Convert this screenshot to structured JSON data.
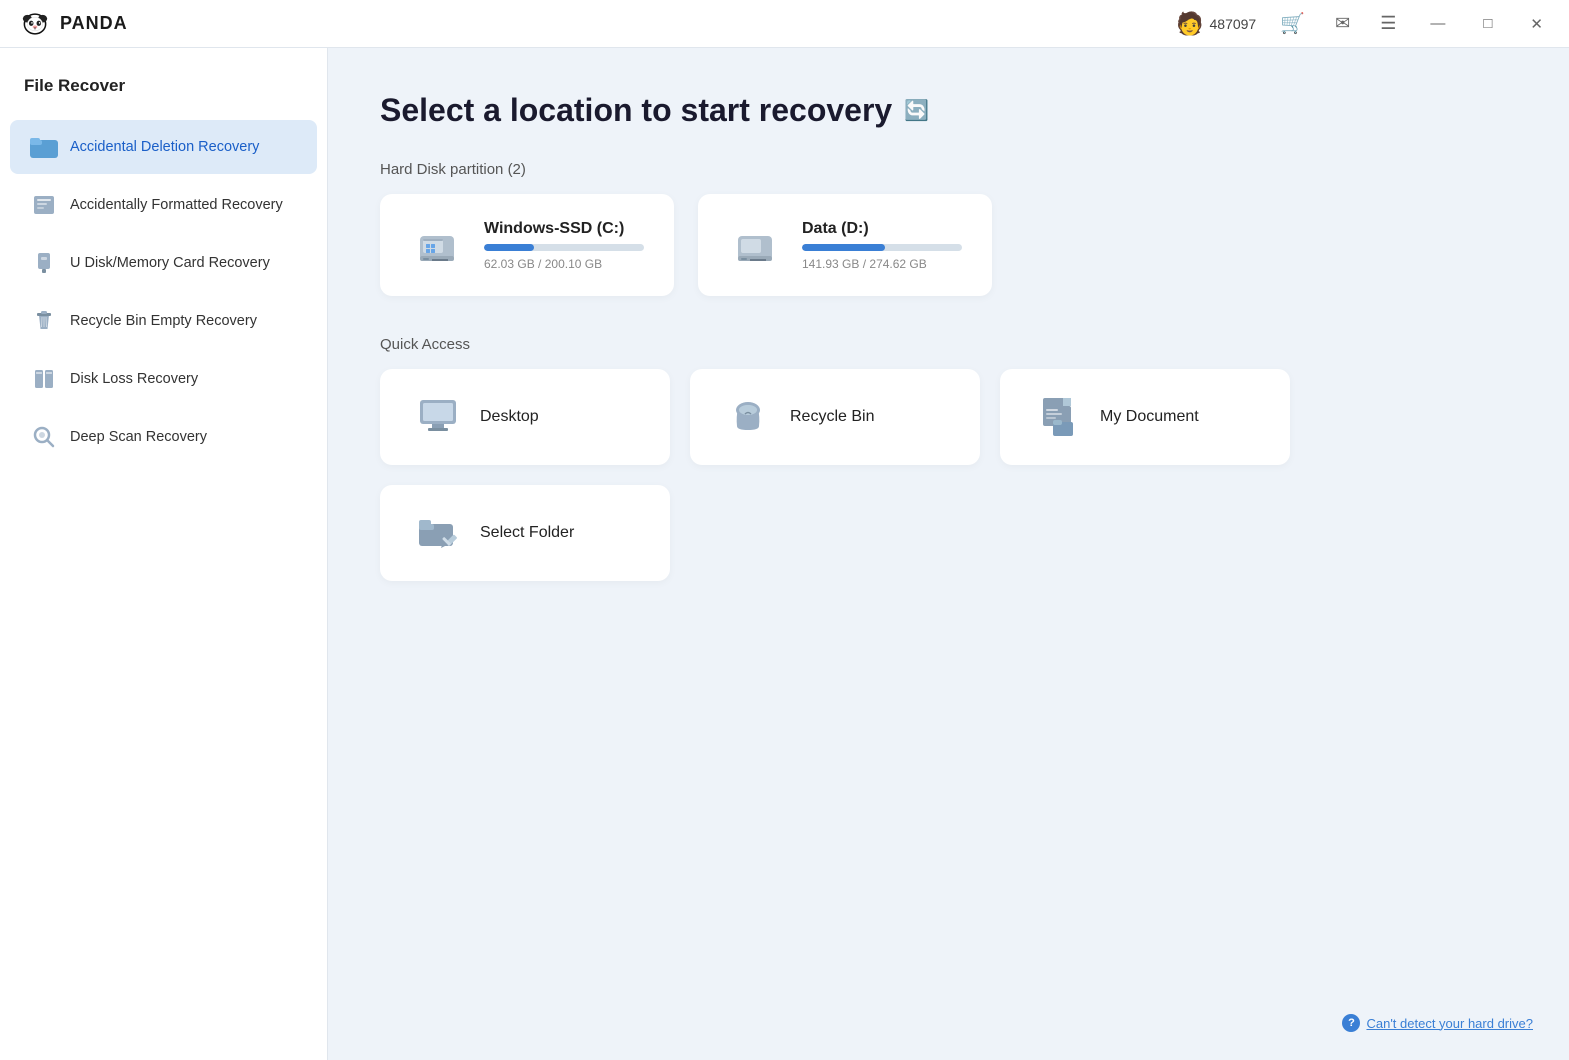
{
  "titlebar": {
    "user_id": "487097",
    "minimize_label": "—",
    "maximize_label": "□",
    "close_label": "✕"
  },
  "sidebar": {
    "title": "File Recover",
    "items": [
      {
        "id": "accidental-deletion",
        "label": "Accidental Deletion Recovery",
        "active": true
      },
      {
        "id": "accidentally-formatted",
        "label": "Accidentally Formatted Recovery",
        "active": false
      },
      {
        "id": "u-disk",
        "label": "U Disk/Memory Card Recovery",
        "active": false
      },
      {
        "id": "recycle-bin-empty",
        "label": "Recycle Bin Empty Recovery",
        "active": false
      },
      {
        "id": "disk-loss",
        "label": "Disk Loss Recovery",
        "active": false
      },
      {
        "id": "deep-scan",
        "label": "Deep Scan Recovery",
        "active": false
      }
    ]
  },
  "main": {
    "page_title": "Select a location to start recovery",
    "hard_disk_section_label": "Hard Disk partition",
    "hard_disk_count": "(2)",
    "disks": [
      {
        "name": "Windows-SSD  (C:)",
        "used_gb": "62.03 GB",
        "total_gb": "200.10 GB",
        "fill_percent": 31
      },
      {
        "name": "Data  (D:)",
        "used_gb": "141.93 GB",
        "total_gb": "274.62 GB",
        "fill_percent": 52
      }
    ],
    "quick_access_label": "Quick Access",
    "quick_items": [
      {
        "id": "desktop",
        "label": "Desktop"
      },
      {
        "id": "recycle-bin",
        "label": "Recycle Bin"
      },
      {
        "id": "my-document",
        "label": "My Document"
      },
      {
        "id": "select-folder",
        "label": "Select Folder"
      }
    ],
    "help_link": "Can't detect your hard drive?"
  }
}
